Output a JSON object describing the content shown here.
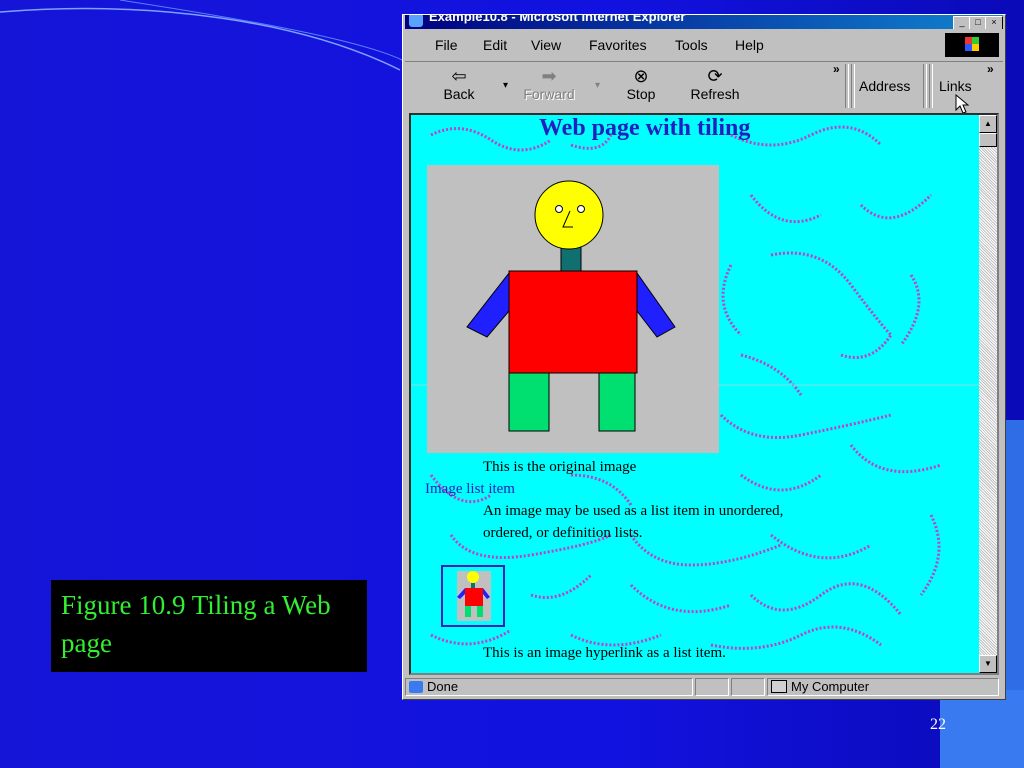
{
  "slide": {
    "caption": "Figure 10.9 Tiling a Web page",
    "page_number": "22"
  },
  "window": {
    "title": "Example10.8 - Microsoft Internet Explorer",
    "controls": [
      "_",
      "□",
      "×"
    ]
  },
  "menu": {
    "items": [
      "File",
      "Edit",
      "View",
      "Favorites",
      "Tools",
      "Help"
    ]
  },
  "toolbar": {
    "back": "Back",
    "forward": "Forward",
    "stop": "Stop",
    "refresh": "Refresh",
    "address": "Address",
    "links": "Links",
    "more": "»"
  },
  "page": {
    "heading": "Web page with tiling",
    "original_caption": "This is the original image",
    "list_item_link": "Image list item",
    "list_item_text_1": "An image may be used as a list item in unordered,",
    "list_item_text_2": "ordered, or definition lists.",
    "hyperlink_caption": "This is an image hyperlink as a list item."
  },
  "statusbar": {
    "status": "Done",
    "zone": "My Computer"
  },
  "colors": {
    "slide_bg": "#1515d8",
    "caption_text": "#33ee33",
    "page_bg": "#00ffff",
    "texture": "#e020c0",
    "heading": "#2020c0"
  }
}
